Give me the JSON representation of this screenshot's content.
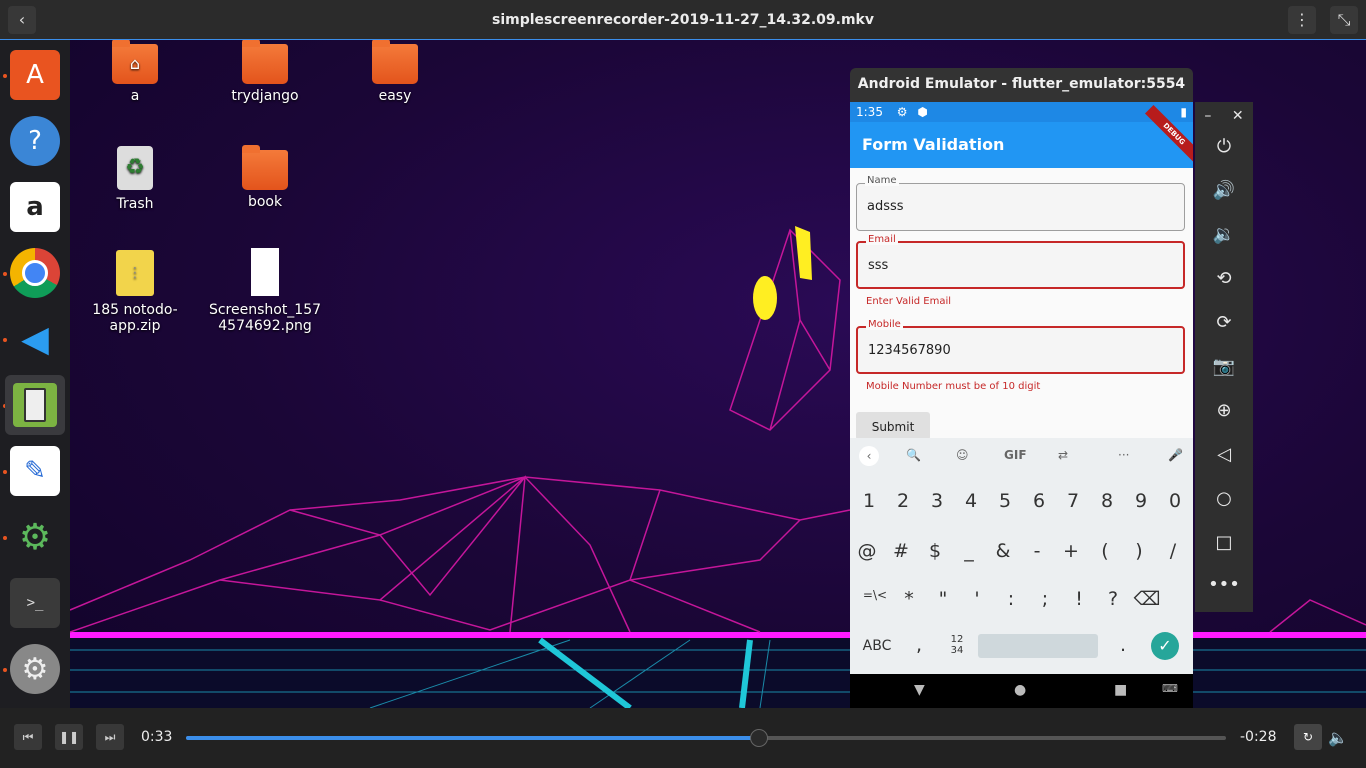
{
  "player": {
    "title": "simplescreenrecorder-2019-11-27_14.32.09.mkv",
    "elapsed": "0:33",
    "remaining": "-0:28",
    "progress": 0.55
  },
  "desktop": {
    "icons": [
      {
        "label": "a",
        "kind": "home-folder"
      },
      {
        "label": "trydjango",
        "kind": "folder"
      },
      {
        "label": "easy",
        "kind": "folder"
      },
      {
        "label": "Trash",
        "kind": "trash"
      },
      {
        "label": "book",
        "kind": "folder"
      },
      {
        "label": "185 notodo-app.zip",
        "kind": "zip"
      },
      {
        "label": "Screenshot_1574574692.png",
        "kind": "image"
      }
    ]
  },
  "emulator": {
    "window_title": "Android Emulator - flutter_emulator:5554",
    "status_time": "1:35",
    "debug_banner": "DEBUG",
    "app_title": "Form Validation",
    "fields": [
      {
        "label": "Name",
        "value": "adsss",
        "error": ""
      },
      {
        "label": "Email",
        "value": "sss",
        "error": "Enter Valid Email"
      },
      {
        "label": "Mobile",
        "value": "1234567890",
        "error": "Mobile Number must be of 10 digit"
      }
    ],
    "submit_label": "Submit",
    "keyboard": {
      "toolbar": [
        "‹",
        "🔍",
        "☺",
        "GIF",
        "⇄",
        "···",
        "🎤"
      ],
      "row1": [
        "1",
        "2",
        "3",
        "4",
        "5",
        "6",
        "7",
        "8",
        "9",
        "0"
      ],
      "row2": [
        "@",
        "#",
        "$",
        "_",
        "&",
        "-",
        "+",
        "(",
        ")",
        "/"
      ],
      "row3": [
        "=\\<",
        "*",
        "\"",
        "'",
        ":",
        ";",
        "!",
        "?",
        "⌫"
      ],
      "abc": "ABC",
      "comma": ",",
      "numpad": "12\n34",
      "period": ".",
      "done": "✓"
    }
  },
  "side_toolbar": [
    "power-icon",
    "volume-up-icon",
    "volume-down-icon",
    "rotate-left-icon",
    "rotate-right-icon",
    "camera-icon",
    "zoom-icon",
    "back-icon",
    "home-icon",
    "overview-icon",
    "more-icon"
  ]
}
